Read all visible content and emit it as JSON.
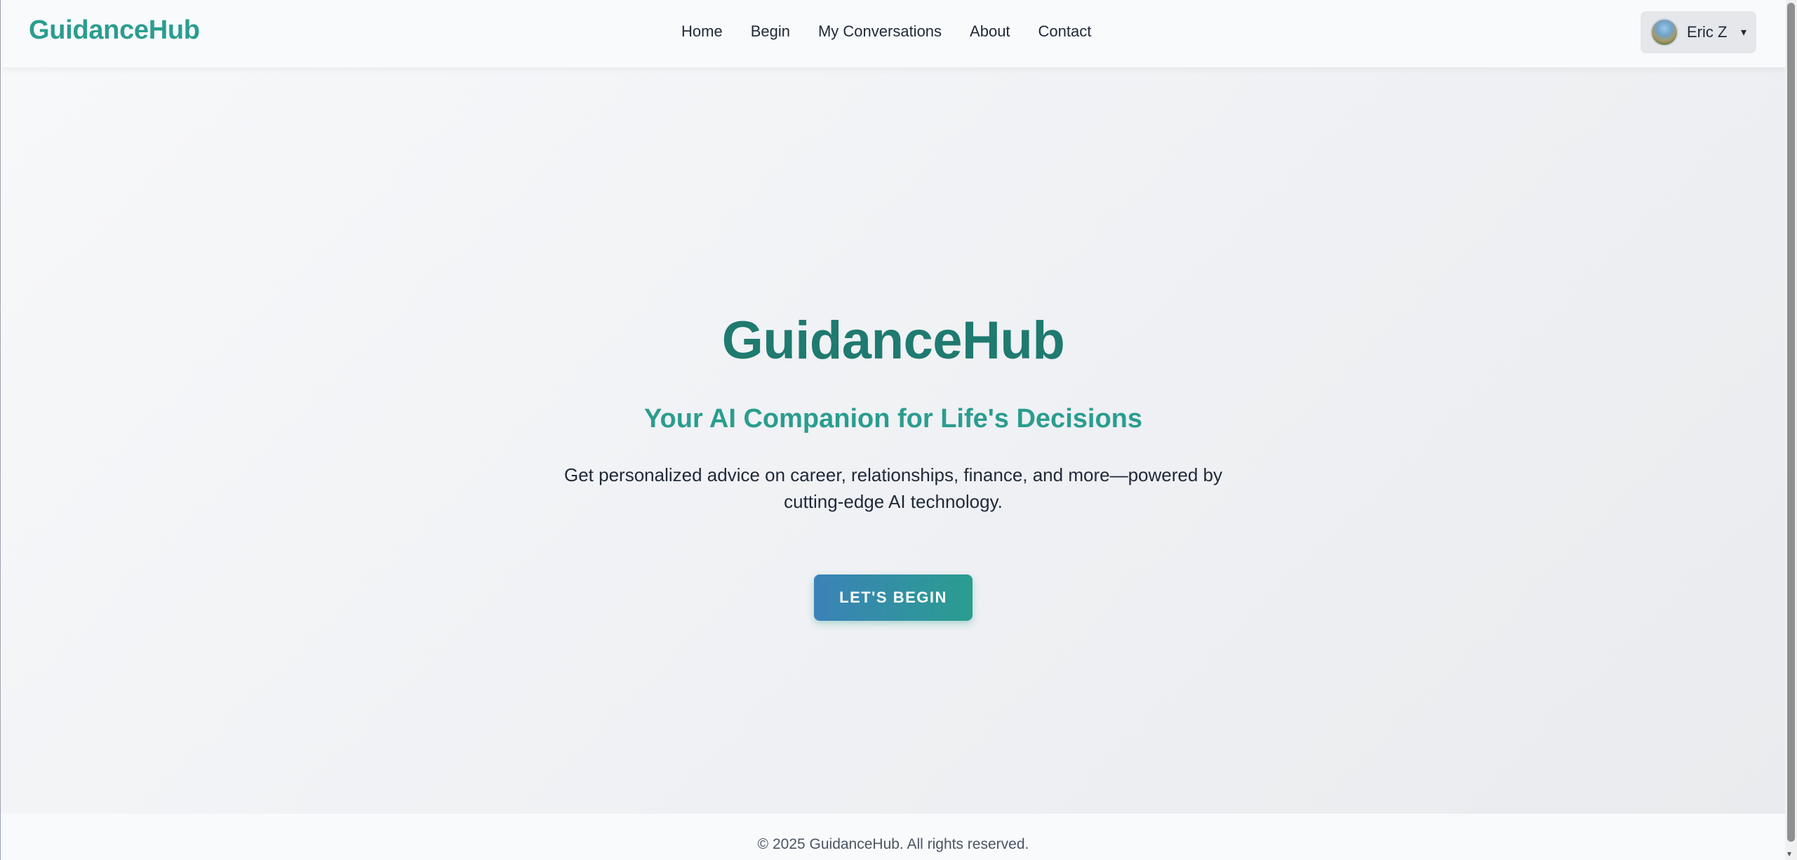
{
  "header": {
    "logo": "GuidanceHub",
    "nav": [
      "Home",
      "Begin",
      "My Conversations",
      "About",
      "Contact"
    ],
    "user": {
      "name": "Eric Z",
      "caret": "▾"
    }
  },
  "hero": {
    "title": "GuidanceHub",
    "subtitle": "Your AI Companion for Life's Decisions",
    "description": "Get personalized advice on career, relationships, finance, and more—powered by cutting-edge AI technology.",
    "cta_label": "LET'S BEGIN"
  },
  "footer": {
    "copyright": "© 2025 GuidanceHub. All rights reserved."
  },
  "colors": {
    "brand": "#2a9d8f",
    "brand_dark": "#1f7a70",
    "cta_gradient_start": "#3b82b8",
    "cta_gradient_end": "#2a9d8f"
  }
}
